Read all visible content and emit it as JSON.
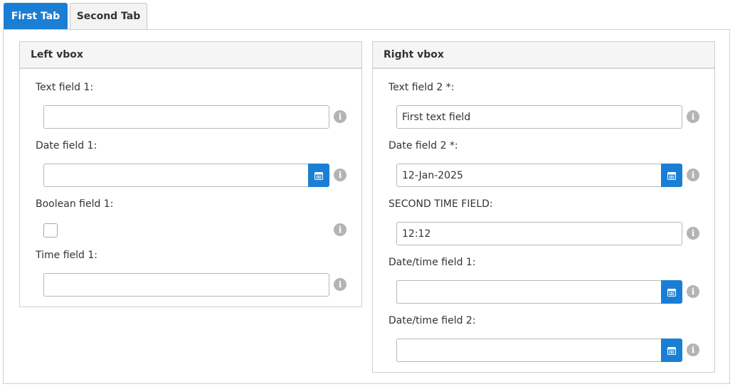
{
  "tabs": [
    {
      "label": "First Tab",
      "active": true
    },
    {
      "label": "Second Tab",
      "active": false
    }
  ],
  "left_vbox": {
    "title": "Left vbox",
    "text_field_1": {
      "label": "Text field 1:",
      "value": ""
    },
    "date_field_1": {
      "label": "Date field 1:",
      "value": ""
    },
    "boolean_field_1": {
      "label": "Boolean field 1:",
      "checked": false
    },
    "time_field_1": {
      "label": "Time field 1:",
      "value": ""
    }
  },
  "right_vbox": {
    "title": "Right vbox",
    "text_field_2": {
      "label": "Text field 2 *:",
      "value": "First text field"
    },
    "date_field_2": {
      "label": "Date field 2 *:",
      "value": "12-Jan-2025"
    },
    "second_time_field": {
      "label": "SECOND TIME FIELD:",
      "value": "12:12"
    },
    "datetime_field_1": {
      "label": "Date/time field 1:",
      "value": ""
    },
    "datetime_field_2": {
      "label": "Date/time field 2:",
      "value": ""
    }
  },
  "icons": {
    "info": "info-icon",
    "calendar": "calendar-icon"
  },
  "colors": {
    "accent": "#1a7fd4",
    "info_icon": "#b4b4b4",
    "header_bg": "#f5f5f5"
  }
}
